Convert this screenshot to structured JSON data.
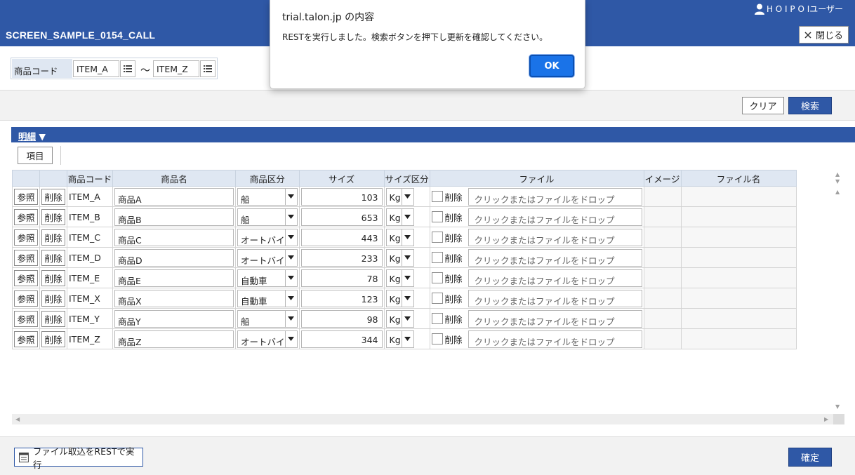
{
  "header": {
    "title": "SCREEN_SAMPLE_0154_CALL",
    "user": "H O I P O Iユーザー",
    "close_label": "閉じる"
  },
  "search": {
    "label": "商品コード",
    "from_value": "ITEM_A",
    "to_value": "ITEM_Z",
    "separator": "～"
  },
  "toolbar": {
    "clear_label": "クリア",
    "search_label": "検索"
  },
  "detail": {
    "section_title": "明細",
    "section_arrow": "▼",
    "items_button": "項目",
    "columns": [
      "",
      "",
      "商品コード",
      "商品名",
      "商品区分",
      "サイズ",
      "サイズ区分",
      "ファイル",
      "イメージ",
      "ファイル名"
    ],
    "ref_label": "参照",
    "delete_label": "削除",
    "file_delete_label": "削除",
    "drop_placeholder": "クリックまたはファイルをドロップ",
    "rows": [
      {
        "code": "ITEM_A",
        "name": "商品A",
        "category": "船",
        "size": "103",
        "unit": "Kg"
      },
      {
        "code": "ITEM_B",
        "name": "商品B",
        "category": "船",
        "size": "653",
        "unit": "Kg"
      },
      {
        "code": "ITEM_C",
        "name": "商品C",
        "category": "オートバイ",
        "size": "443",
        "unit": "Kg"
      },
      {
        "code": "ITEM_D",
        "name": "商品D",
        "category": "オートバイ",
        "size": "233",
        "unit": "Kg"
      },
      {
        "code": "ITEM_E",
        "name": "商品E",
        "category": "自動車",
        "size": "78",
        "unit": "Kg"
      },
      {
        "code": "ITEM_X",
        "name": "商品X",
        "category": "自動車",
        "size": "123",
        "unit": "Kg"
      },
      {
        "code": "ITEM_Y",
        "name": "商品Y",
        "category": "船",
        "size": "98",
        "unit": "Kg"
      },
      {
        "code": "ITEM_Z",
        "name": "商品Z",
        "category": "オートバイ",
        "size": "344",
        "unit": "Kg"
      }
    ]
  },
  "footer": {
    "rest_button": "ファイル取込をRESTで実行",
    "confirm_label": "確定"
  },
  "dialog": {
    "title": "trial.talon.jp の内容",
    "message": "RESTを実行しました。検索ボタンを押下し更新を確認してください。",
    "ok_label": "OK"
  },
  "colors": {
    "brand": "#2f58a6",
    "header_cell": "#dfe7f2",
    "dialog_button": "#1a73e8"
  }
}
